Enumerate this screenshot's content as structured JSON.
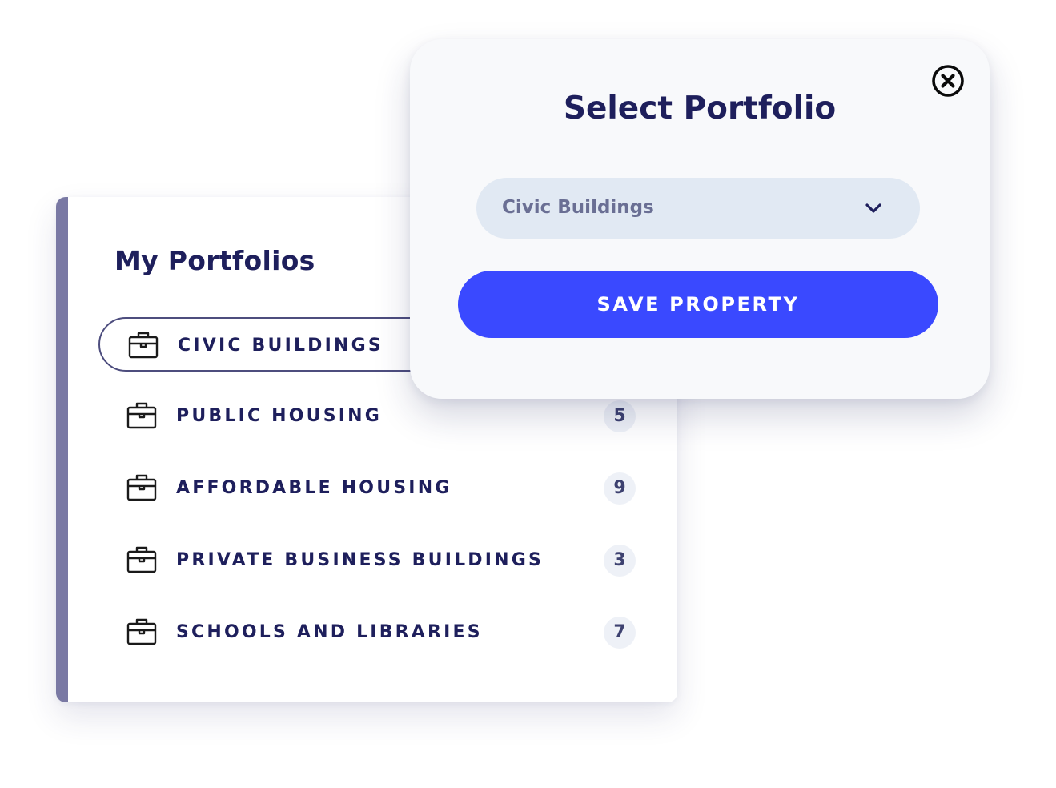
{
  "portfolios": {
    "title": "My Portfolios",
    "items": [
      {
        "label": "CIVIC BUILDINGS",
        "count": "",
        "icon": "briefcase-icon",
        "selected": true
      },
      {
        "label": "PUBLIC HOUSING",
        "count": "5",
        "icon": "briefcase-icon",
        "selected": false
      },
      {
        "label": "AFFORDABLE HOUSING",
        "count": "9",
        "icon": "briefcase-icon",
        "selected": false
      },
      {
        "label": "PRIVATE BUSINESS BUILDINGS",
        "count": "3",
        "icon": "briefcase-icon",
        "selected": false
      },
      {
        "label": "SCHOOLS AND LIBRARIES",
        "count": "7",
        "icon": "briefcase-icon",
        "selected": false
      }
    ]
  },
  "modal": {
    "title": "Select Portfolio",
    "close_icon": "close-circle-icon",
    "select": {
      "value": "Civic Buildings",
      "icon": "chevron-down-icon"
    },
    "save_label": "SAVE PROPERTY"
  },
  "colors": {
    "primary_text": "#1e1f5c",
    "accent_bar": "#7a79a4",
    "button": "#3a49ff",
    "select_bg": "#e1e9f3",
    "count_bg": "#eef1f7"
  }
}
